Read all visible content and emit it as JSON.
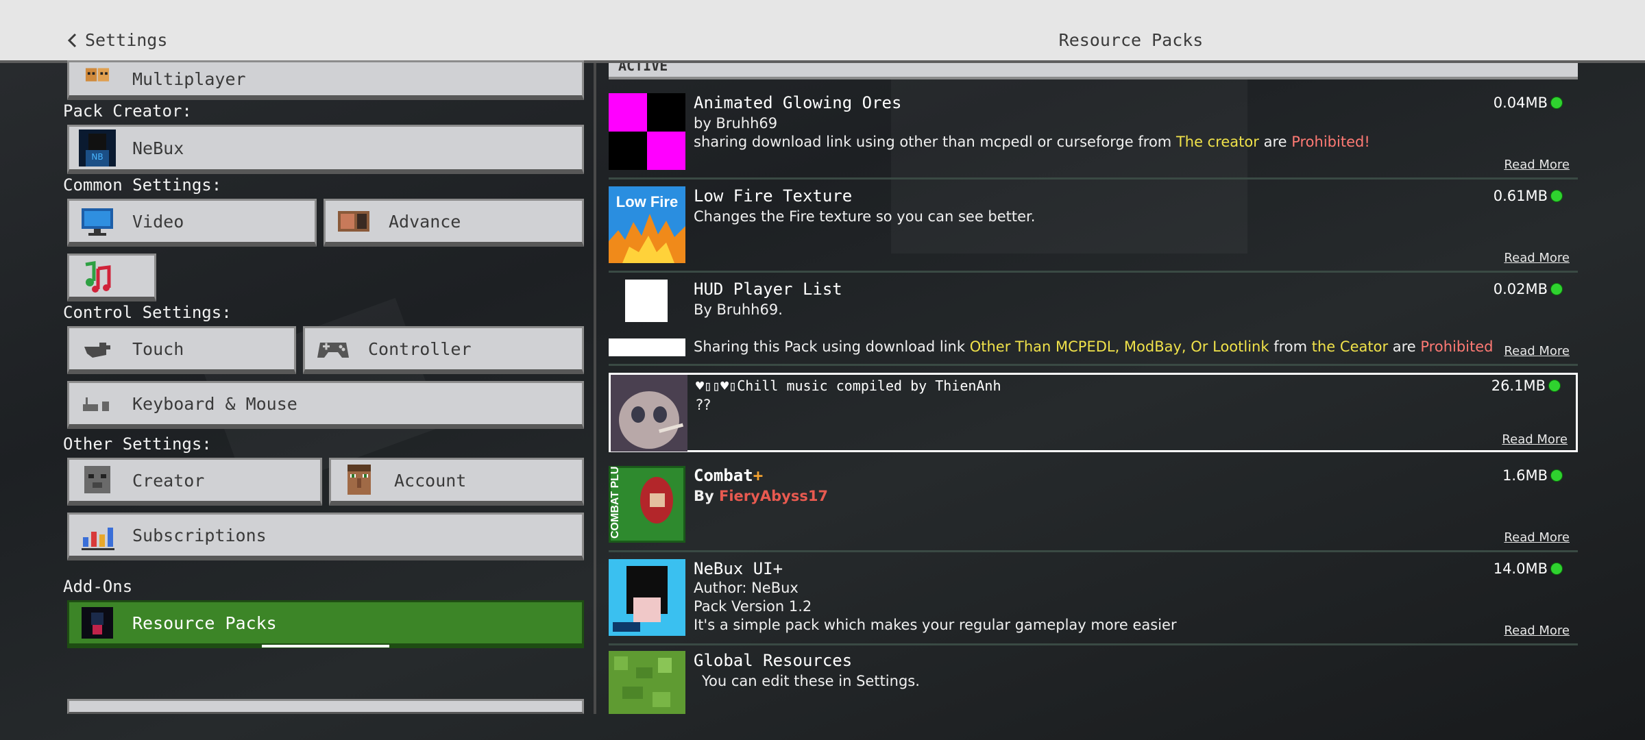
{
  "topbar": {
    "back_label": "Settings",
    "title": "Resource Packs"
  },
  "left": {
    "multiplayer_label": "Multiplayer",
    "pack_creator_heading": "Pack Creator:",
    "pack_creator_name": "NeBux",
    "common_heading": "Common Settings:",
    "video_label": "Video",
    "advance_label": "Advance",
    "control_heading": "Control Settings:",
    "touch_label": "Touch",
    "controller_label": "Controller",
    "keyboard_label": "Keyboard & Mouse",
    "other_heading": "Other Settings:",
    "creator_label": "Creator",
    "account_label": "Account",
    "subscriptions_label": "Subscriptions",
    "addons_heading": "Add-Ons",
    "resource_packs_label": "Resource Packs"
  },
  "right": {
    "active_header": "ACTIVE",
    "read_more": "Read More",
    "packs": [
      {
        "name": "Animated Glowing Ores",
        "author": "by Bruhh69",
        "desc_a": "sharing download link using other than mcpedl or curseforge from ",
        "desc_b": "The creator",
        "desc_c": " are ",
        "desc_d": "Prohibited!",
        "size": "0.04MB"
      },
      {
        "name": "Low Fire Texture",
        "desc": "Changes the Fire texture so you can see better.",
        "thumb_text": "Low Fire",
        "size": "0.61MB"
      },
      {
        "name": "HUD Player List",
        "author": "By Bruhh69.",
        "desc_a": "Sharing this Pack using download link ",
        "desc_b": "Other Than MCPEDL, ModBay, Or Lootlink",
        "desc_c": " from ",
        "desc_d": "the Ceator",
        "desc_e": " are ",
        "desc_f": "Prohibited",
        "size": "0.02MB"
      },
      {
        "name": "♥▯▯♥▯Chill music compiled by ThienAnh",
        "desc": "??",
        "size": "26.1MB"
      },
      {
        "name_a": "Combat",
        "name_b": "+",
        "author_a": "By ",
        "author_b": "FieryAbyss17",
        "thumb_text": "COMBAT PLUS",
        "size": "1.6MB"
      },
      {
        "name": "NeBux UI+",
        "line1": "Author: NeBux",
        "line2": "Pack Version 1.2",
        "line3": "It's a simple pack which makes your regular gameplay more easier",
        "size": "14.0MB"
      },
      {
        "name": "Global Resources",
        "desc": "You can edit these in Settings."
      }
    ]
  }
}
